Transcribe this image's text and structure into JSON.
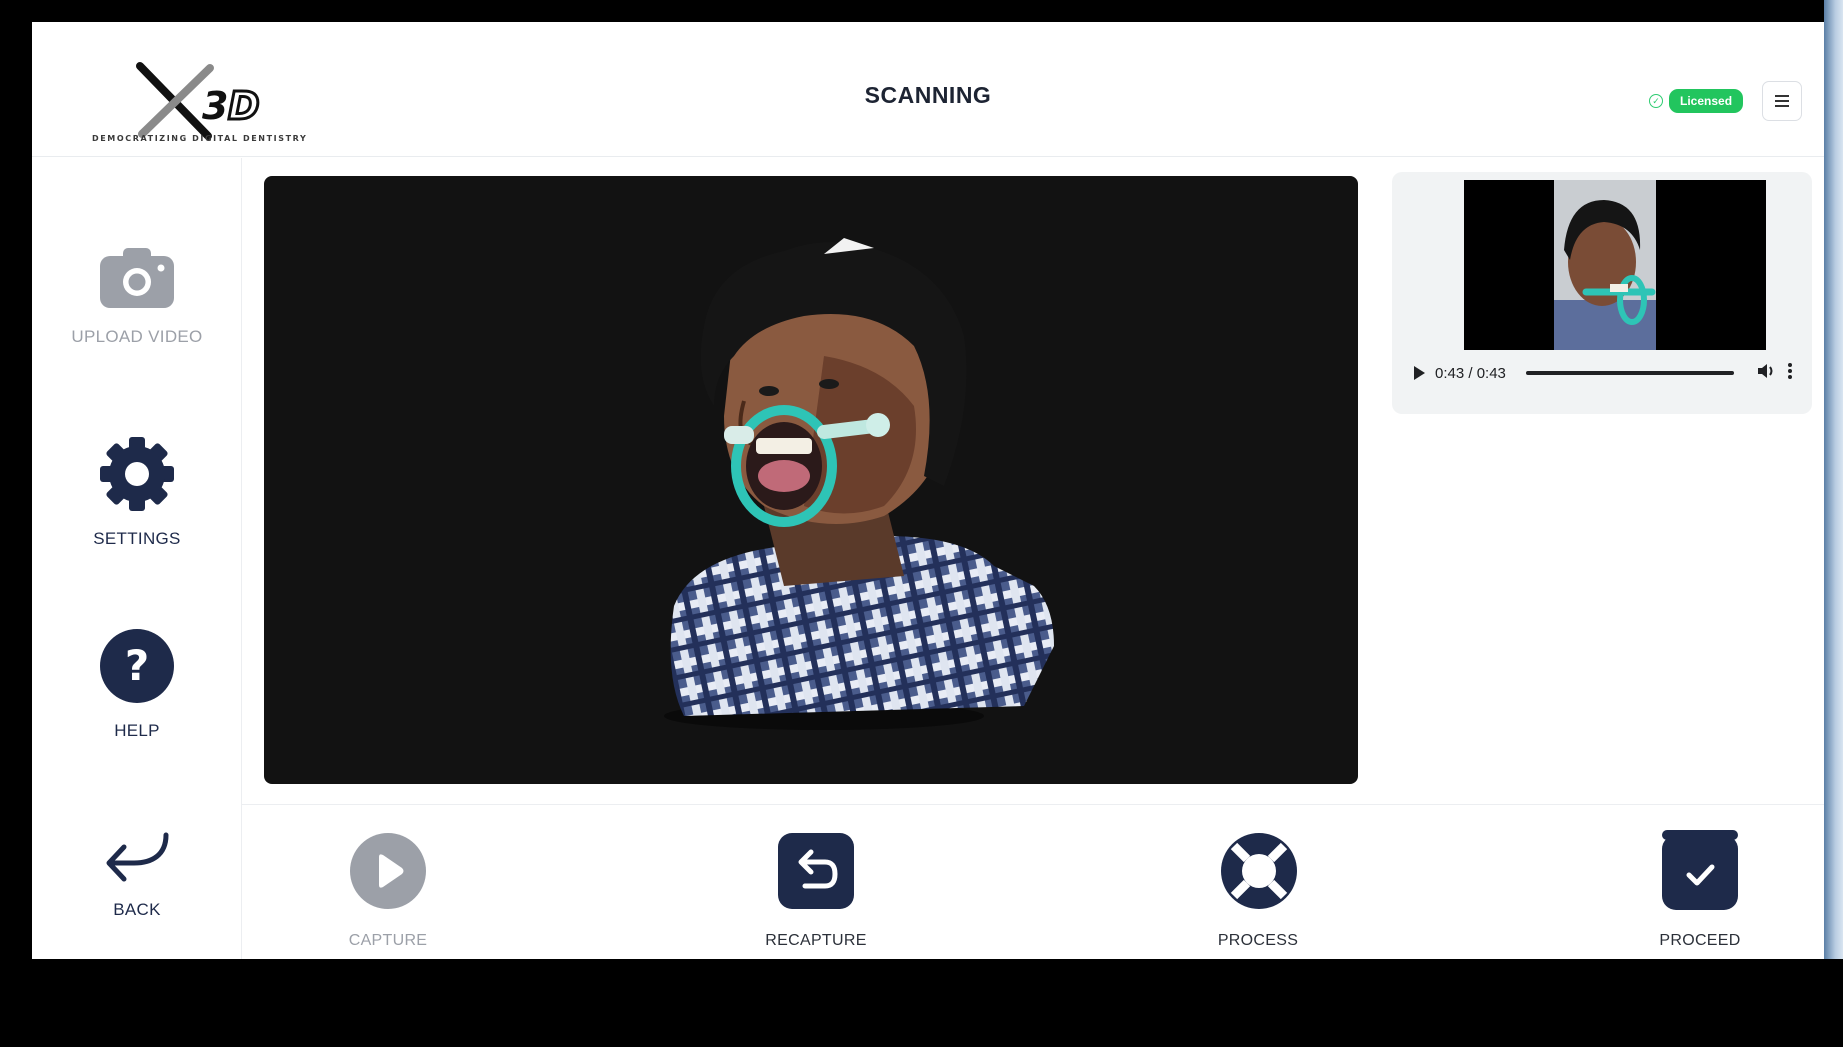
{
  "header": {
    "logo_text": "X3D",
    "logo_tagline": "DEMOCRATIZING DIGITAL DENTISTRY",
    "title": "SCANNING",
    "license_label": "Licensed",
    "menu_icon": "hamburger-menu-icon"
  },
  "sidebar": {
    "items": [
      {
        "label": "UPLOAD VIDEO",
        "icon": "camera-icon",
        "enabled": false
      },
      {
        "label": "SETTINGS",
        "icon": "gear-icon",
        "enabled": true
      },
      {
        "label": "HELP",
        "icon": "help-icon",
        "enabled": true
      },
      {
        "label": "BACK",
        "icon": "back-arrow-icon",
        "enabled": true
      }
    ]
  },
  "video": {
    "time": "0:43 / 0:43",
    "progress": 1.0
  },
  "toolbar": {
    "buttons": [
      {
        "label": "CAPTURE",
        "icon": "play-circle-icon",
        "enabled": false
      },
      {
        "label": "RECAPTURE",
        "icon": "undo-icon",
        "enabled": true
      },
      {
        "label": "PROCESS",
        "icon": "lifebuoy-icon",
        "enabled": true
      },
      {
        "label": "PROCEED",
        "icon": "check-icon",
        "enabled": true
      }
    ]
  },
  "colors": {
    "primary": "#1e2a4a",
    "disabled": "#9ca0a8",
    "licensed": "#22c55e",
    "viewer_bg": "#121212",
    "mouth_retractor": "#2ec4b6"
  }
}
